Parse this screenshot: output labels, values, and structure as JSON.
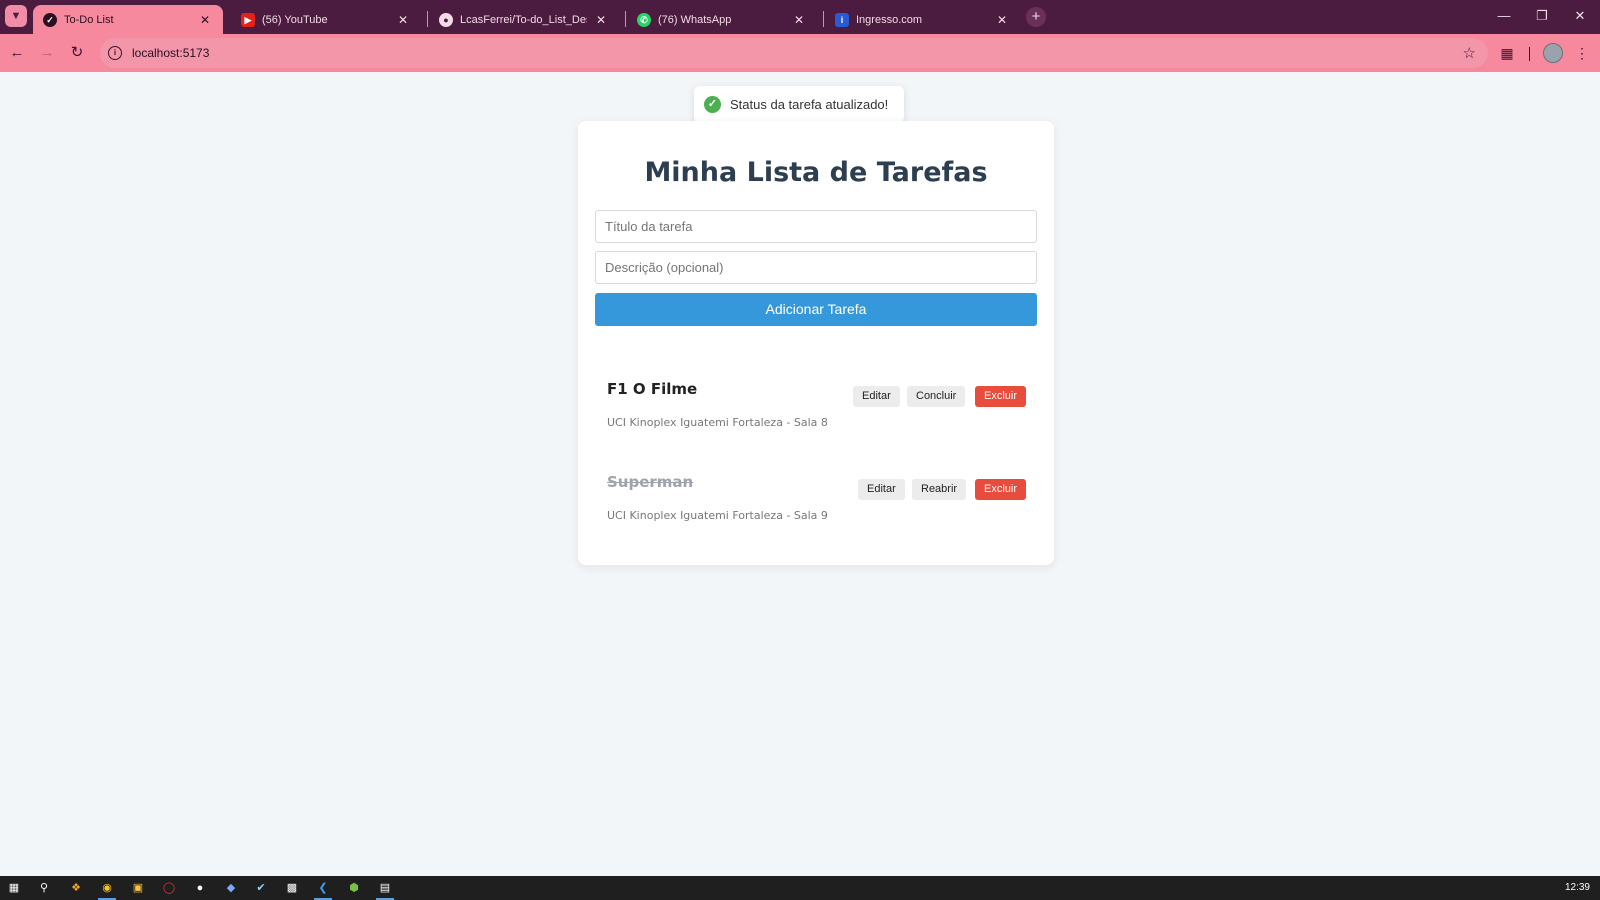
{
  "browser": {
    "tabs": [
      {
        "title": "To-Do List",
        "icon": "checklist-icon"
      },
      {
        "title": "(56) YouTube",
        "icon": "youtube-icon"
      },
      {
        "title": "LcasFerrei/To-do_List_Desafio: [",
        "icon": "github-icon"
      },
      {
        "title": "(76) WhatsApp",
        "icon": "whatsapp-icon"
      },
      {
        "title": "Ingresso.com",
        "icon": "info-icon"
      }
    ],
    "url": "localhost:5173"
  },
  "toast": {
    "message": "Status da tarefa atualizado!",
    "color": "#4caf50"
  },
  "app": {
    "title": "Minha Lista de Tarefas",
    "title_placeholder": "Título da tarefa",
    "description_placeholder": "Descrição (opcional)",
    "add_button_label": "Adicionar Tarefa",
    "accent_color": "#3498db",
    "danger_color": "#e74c3c",
    "tasks": [
      {
        "title": "F1 O Filme",
        "description": "UCI Kinoplex Iguatemi Fortaleza - Sala 8",
        "completed": false,
        "edit_label": "Editar",
        "toggle_label": "Concluir",
        "delete_label": "Excluir"
      },
      {
        "title": "Superman",
        "description": "UCI Kinoplex Iguatemi Fortaleza - Sala 9",
        "completed": true,
        "edit_label": "Editar",
        "toggle_label": "Reabrir",
        "delete_label": "Excluir"
      }
    ]
  },
  "taskbar": {
    "clock": "12:39"
  }
}
